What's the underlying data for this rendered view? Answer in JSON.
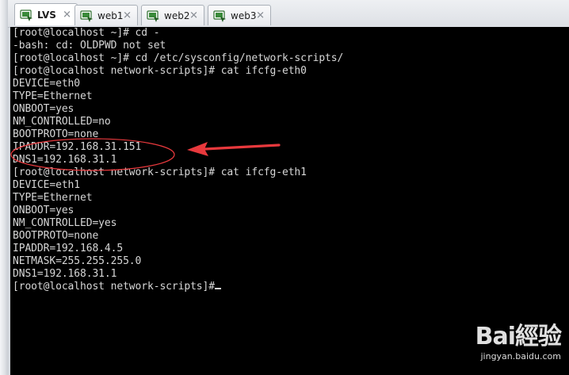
{
  "tabs": [
    {
      "label": "LVS",
      "active": true
    },
    {
      "label": "web1",
      "active": false
    },
    {
      "label": "web2",
      "active": false
    },
    {
      "label": "web3",
      "active": false
    }
  ],
  "terminal": {
    "lines": [
      "[root@localhost ~]# cd -",
      "-bash: cd: OLDPWD not set",
      "[root@localhost ~]# cd /etc/sysconfig/network-scripts/",
      "[root@localhost network-scripts]# cat ifcfg-eth0",
      "DEVICE=eth0",
      "TYPE=Ethernet",
      "ONBOOT=yes",
      "NM_CONTROLLED=no",
      "BOOTPROTO=none",
      "IPADDR=192.168.31.151",
      "DNS1=192.168.31.1",
      "[root@localhost network-scripts]# cat ifcfg-eth1",
      "DEVICE=eth1",
      "TYPE=Ethernet",
      "ONBOOT=yes",
      "NM_CONTROLLED=yes",
      "BOOTPROTO=none",
      "IPADDR=192.168.4.5",
      "NETMASK=255.255.255.0",
      "DNS1=192.168.31.1",
      "[root@localhost network-scripts]#"
    ]
  },
  "annotation": {
    "color": "#e8393d"
  },
  "watermark": {
    "logo": "Bai經验",
    "url": "jingyan.baidu.com"
  }
}
